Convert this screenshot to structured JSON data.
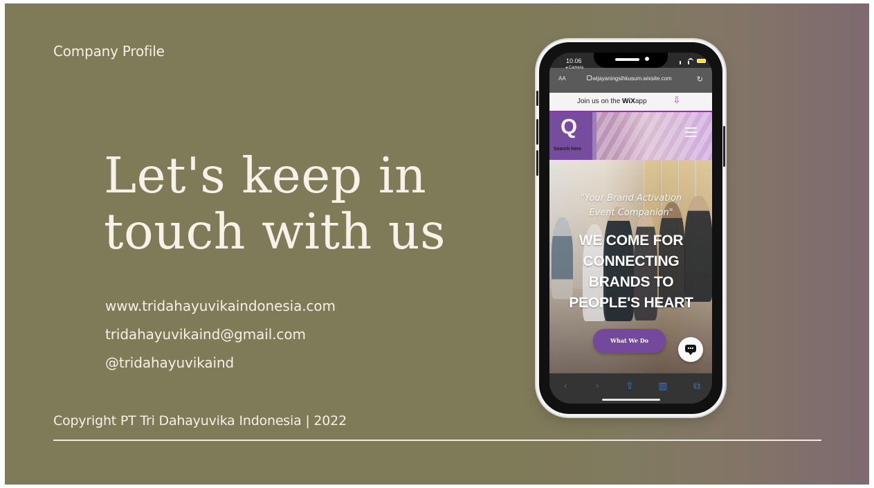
{
  "slide": {
    "eyebrow": "Company Profile",
    "headline": "Let's keep in\ntouch with us",
    "contacts": [
      "www.tridahayuvikaindonesia.com",
      "tridahayuvikaind@gmail.com",
      "@tridahayuvikaind"
    ],
    "footer": "Copyright PT Tri Dahayuvika Indonesia | 2022",
    "colors": {
      "background": "#7f7a57",
      "right_tint": "#7e6a70",
      "text": "#f4f1e7",
      "rule": "#f2f0ea"
    }
  },
  "phone": {
    "status": {
      "time": "10.06",
      "back_label": "◂ Camera"
    },
    "browser": {
      "text_size": "AA",
      "url": "wijayaningsihkusum.wixsite.com",
      "reload_icon": "reload-icon"
    },
    "wix_banner": {
      "prefix": "Join us on the",
      "brand": "WiX",
      "suffix": "app",
      "download_icon": "download-icon",
      "accent": "#9b2cae"
    },
    "site": {
      "search_letter": "Q",
      "search_label": "Search here",
      "menu_icon": "hamburger-menu-icon"
    },
    "hero": {
      "tagline": "\"Your Brand Activation\nEvent Companion\"",
      "title": "WE COME FOR\nCONNECTING\nBRANDS TO\nPEOPLE'S HEART",
      "cta_label": "What We Do",
      "chat_icon": "chat-icon",
      "accent": "#74489a"
    },
    "toolbar": {
      "back": "‹",
      "forward": "›",
      "share": "⇪",
      "bookmarks": "▥",
      "tabs": "⧉"
    }
  }
}
